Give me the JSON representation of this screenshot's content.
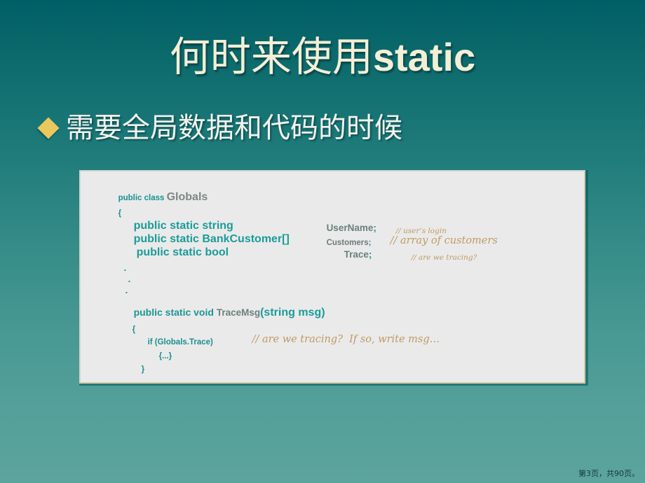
{
  "slide": {
    "title_cjk": "何时来使用static",
    "title_cjk_prefix": "何时来使用",
    "title_latin": "static",
    "bullet": {
      "marker": "diamond-bullet",
      "text": "需要全局数据和代码的时候"
    },
    "footer": "第3页，共90页。"
  },
  "code": {
    "language": "csharp",
    "lines": [
      {
        "id": "line-class-decl",
        "tokens": [
          {
            "t": "public class ",
            "k": "keyword-small"
          },
          {
            "t": "Globals",
            "k": "identifier-large"
          }
        ]
      },
      {
        "id": "line-open-brace-class",
        "tokens": [
          {
            "t": "{",
            "k": "punct-small"
          }
        ]
      },
      {
        "id": "line-field-username",
        "tokens": [
          {
            "t": "public static string",
            "k": "keyword-large"
          },
          {
            "t": "UserName",
            "k": "identifier-medium"
          },
          {
            "t": ";",
            "k": "punct"
          },
          {
            "t": "// user’s login",
            "k": "comment-xs"
          }
        ]
      },
      {
        "id": "line-field-customers",
        "tokens": [
          {
            "t": "public static BankCustomer[]",
            "k": "keyword-large"
          },
          {
            "t": "Customers",
            "k": "identifier-small"
          },
          {
            "t": ";",
            "k": "punct"
          },
          {
            "t": "// array of customers",
            "k": "comment-md"
          }
        ]
      },
      {
        "id": "line-field-trace",
        "tokens": [
          {
            "t": "public static bool",
            "k": "keyword-large"
          },
          {
            "t": "Trace",
            "k": "identifier-medium"
          },
          {
            "t": ";",
            "k": "punct"
          },
          {
            "t": "// are we tracing?",
            "k": "comment-xs"
          }
        ]
      },
      {
        "id": "line-dot-1",
        "tokens": [
          {
            "t": ".",
            "k": "dot"
          }
        ]
      },
      {
        "id": "line-dot-2",
        "tokens": [
          {
            "t": ".",
            "k": "dot"
          }
        ]
      },
      {
        "id": "line-dot-3",
        "tokens": [
          {
            "t": ".",
            "k": "dot"
          }
        ]
      },
      {
        "id": "line-method-tracemsg",
        "tokens": [
          {
            "t": "public static void ",
            "k": "keyword-medium"
          },
          {
            "t": "TraceMsg",
            "k": "identifier-medium"
          },
          {
            "t": "(string msg)",
            "k": "keyword-large"
          }
        ]
      },
      {
        "id": "line-open-brace-method",
        "tokens": [
          {
            "t": "{",
            "k": "punct-small"
          }
        ]
      },
      {
        "id": "line-if-trace",
        "tokens": [
          {
            "t": "if (Globals.Trace)",
            "k": "keyword-small"
          },
          {
            "t": "// are we tracing?  If so, write msg…",
            "k": "comment-md"
          }
        ]
      },
      {
        "id": "line-body-ellipsis",
        "tokens": [
          {
            "t": "{...}",
            "k": "punct-small"
          }
        ]
      },
      {
        "id": "line-close-brace-method",
        "tokens": [
          {
            "t": "}",
            "k": "punct-small"
          }
        ]
      }
    ],
    "text": {
      "l1_kw": "public class",
      "l1_name": "Globals",
      "l2_brace": "{",
      "l3_kw": "public static string",
      "l3_name": "UserName",
      "l3_semi": ";",
      "l3_cmt": "// user’s login",
      "l4_kw": "public static BankCustomer[]",
      "l4_name": "Customers",
      "l4_semi": ";",
      "l4_cmt": "// array of customers",
      "l5_kw": "public static bool",
      "l5_name": "Trace",
      "l5_semi": ";",
      "l5_cmt": "// are we tracing?",
      "dot": ".",
      "l9_kw": "public static void",
      "l9_name": "TraceMsg",
      "l9_sig": "(string msg)",
      "l10_brace": "{",
      "l11_if": "if (Globals.Trace)",
      "l11_cmt": "// are we tracing?  If so, write msg…",
      "l12_body": "{...}",
      "l13_brace": "}"
    }
  },
  "colors": {
    "bg_top": "#005f66",
    "bg_bottom": "#5ca49d",
    "title": "#f3efd6",
    "bullet_marker": "#e9c95e",
    "bullet_text": "#f4f4ee",
    "code_bg": "#eaeaea",
    "code_keyword": "#18908f",
    "code_identifier": "#6e7a78",
    "code_comment": "#c09a63",
    "footer": "#123a3e"
  }
}
